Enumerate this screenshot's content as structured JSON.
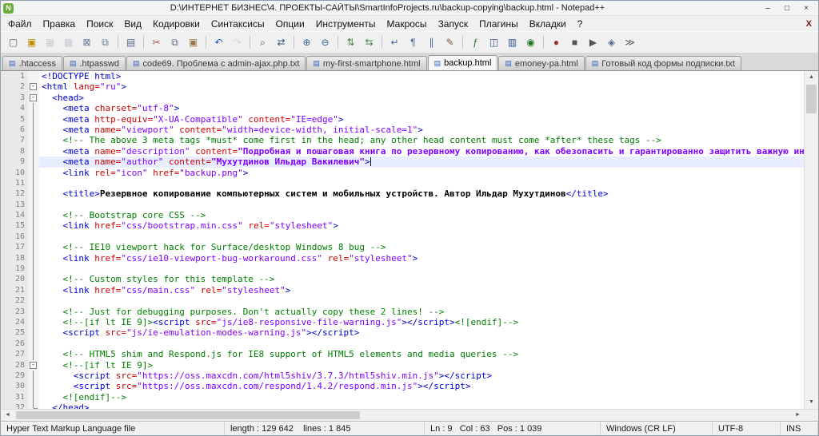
{
  "window": {
    "title": "D:\\ИНТЕРНЕТ БИЗНЕС\\4. ПРОЕКТЫ-САЙТЫ\\SmartInfoProjects.ru\\backup-copying\\backup.html - Notepad++",
    "app_initial": "N",
    "controls": {
      "minimize": "–",
      "maximize": "□",
      "close": "×"
    }
  },
  "menu": {
    "items": [
      "Файл",
      "Правка",
      "Поиск",
      "Вид",
      "Кодировки",
      "Синтаксисы",
      "Опции",
      "Инструменты",
      "Макросы",
      "Запуск",
      "Плагины",
      "Вкладки",
      "?"
    ],
    "close_label": "X"
  },
  "tab_icon_glyph": "▤",
  "tabs": [
    {
      "label": ".htaccess",
      "active": false
    },
    {
      "label": ".htpasswd",
      "active": false
    },
    {
      "label": "code69. Проблема с admin-ajax.php.txt",
      "active": false
    },
    {
      "label": "my-first-smartphone.html",
      "active": false
    },
    {
      "label": "backup.html",
      "active": true
    },
    {
      "label": "emoney-pa.html",
      "active": false
    },
    {
      "label": "Готовый код формы подписки.txt",
      "active": false
    }
  ],
  "toolbar": {
    "buttons": [
      {
        "name": "new-file",
        "glyph": "▢",
        "color": "#666666"
      },
      {
        "name": "open-file",
        "glyph": "▣",
        "color": "#c08f00"
      },
      {
        "name": "save",
        "glyph": "▦",
        "color": "#8899aa",
        "disabled": true
      },
      {
        "name": "save-all",
        "glyph": "▩",
        "color": "#8899aa",
        "disabled": true
      },
      {
        "name": "close",
        "glyph": "⊠",
        "color": "#667799"
      },
      {
        "name": "close-all",
        "glyph": "⧉",
        "color": "#667799"
      },
      {
        "name": "print",
        "glyph": "▤",
        "color": "#556688",
        "sep": true
      },
      {
        "name": "cut",
        "glyph": "✂",
        "color": "#aa5555",
        "sep": true
      },
      {
        "name": "copy",
        "glyph": "⧉",
        "color": "#556688"
      },
      {
        "name": "paste",
        "glyph": "▣",
        "color": "#997744"
      },
      {
        "name": "undo",
        "glyph": "↶",
        "color": "#2255cc",
        "sep": true
      },
      {
        "name": "redo",
        "glyph": "↷",
        "color": "#99aabb",
        "disabled": true
      },
      {
        "name": "find",
        "glyph": "⌕",
        "color": "#335577",
        "sep": true
      },
      {
        "name": "replace",
        "glyph": "⇄",
        "color": "#335577"
      },
      {
        "name": "zoom-in",
        "glyph": "⊕",
        "color": "#336699",
        "sep": true
      },
      {
        "name": "zoom-out",
        "glyph": "⊖",
        "color": "#336699"
      },
      {
        "name": "sync-vertical-scroll",
        "glyph": "⇅",
        "color": "#448844",
        "sep": true
      },
      {
        "name": "sync-horizontal-scroll",
        "glyph": "⇆",
        "color": "#448844"
      },
      {
        "name": "word-wrap",
        "glyph": "↵",
        "color": "#446699",
        "sep": true
      },
      {
        "name": "show-all-characters",
        "glyph": "¶",
        "color": "#446699"
      },
      {
        "name": "show-indent-guide",
        "glyph": "∥",
        "color": "#446699"
      },
      {
        "name": "user-defined-language",
        "glyph": "✎",
        "color": "#885533"
      },
      {
        "name": "function-list",
        "glyph": "ƒ",
        "color": "#227722",
        "sep": true
      },
      {
        "name": "document-map",
        "glyph": "◫",
        "color": "#335599"
      },
      {
        "name": "document-switcher",
        "glyph": "▥",
        "color": "#335599"
      },
      {
        "name": "monitoring",
        "glyph": "◉",
        "color": "#227722"
      },
      {
        "name": "record-macro",
        "glyph": "●",
        "color": "#993333",
        "sep": true
      },
      {
        "name": "stop-recording",
        "glyph": "■",
        "color": "#555555"
      },
      {
        "name": "play-macro",
        "glyph": "▶",
        "color": "#555555"
      },
      {
        "name": "save-macro",
        "glyph": "◈",
        "color": "#556699"
      },
      {
        "name": "run-macro-multiple-times",
        "glyph": "≫",
        "color": "#555555"
      }
    ]
  },
  "editor": {
    "lines": [
      {
        "n": 1,
        "fold": "",
        "segs": [
          [
            "t",
            "<!DOCTYPE html>"
          ]
        ]
      },
      {
        "n": 2,
        "fold": "box",
        "segs": [
          [
            "t",
            "<html "
          ],
          [
            "a",
            "lang="
          ],
          [
            "v",
            "\"ru\""
          ],
          [
            "t",
            ">"
          ]
        ]
      },
      {
        "n": 3,
        "fold": "box",
        "segs": [
          [
            "p",
            "  "
          ],
          [
            "t",
            "<head>"
          ]
        ]
      },
      {
        "n": 4,
        "fold": "v",
        "segs": [
          [
            "p",
            "    "
          ],
          [
            "t",
            "<meta "
          ],
          [
            "a",
            "charset="
          ],
          [
            "v",
            "\"utf-8\""
          ],
          [
            "t",
            ">"
          ]
        ]
      },
      {
        "n": 5,
        "fold": "v",
        "segs": [
          [
            "p",
            "    "
          ],
          [
            "t",
            "<meta "
          ],
          [
            "a",
            "http-equiv="
          ],
          [
            "v",
            "\"X-UA-Compatible\""
          ],
          [
            "p",
            " "
          ],
          [
            "a",
            "content="
          ],
          [
            "v",
            "\"IE=edge\""
          ],
          [
            "t",
            ">"
          ]
        ]
      },
      {
        "n": 6,
        "fold": "v",
        "segs": [
          [
            "p",
            "    "
          ],
          [
            "t",
            "<meta "
          ],
          [
            "a",
            "name="
          ],
          [
            "v",
            "\"viewport\""
          ],
          [
            "p",
            " "
          ],
          [
            "a",
            "content="
          ],
          [
            "v",
            "\"width=device-width, initial-scale=1\""
          ],
          [
            "t",
            ">"
          ]
        ]
      },
      {
        "n": 7,
        "fold": "v",
        "segs": [
          [
            "p",
            "    "
          ],
          [
            "c",
            "<!-- The above 3 meta tags *must* come first in the head; any other head content must come *after* these tags -->"
          ]
        ]
      },
      {
        "n": 8,
        "fold": "v",
        "segs": [
          [
            "p",
            "    "
          ],
          [
            "t",
            "<meta "
          ],
          [
            "a",
            "name="
          ],
          [
            "v",
            "\"description\""
          ],
          [
            "p",
            " "
          ],
          [
            "a",
            "content="
          ],
          [
            "v b",
            "\"Подробная и пошаговая книга по резервному копированию, как обезопасить и гарантированно защитить важную информацию от внез"
          ]
        ]
      },
      {
        "n": 9,
        "fold": "v",
        "hl": true,
        "caret": true,
        "segs": [
          [
            "p",
            "    "
          ],
          [
            "t",
            "<meta "
          ],
          [
            "a",
            "name="
          ],
          [
            "v",
            "\"author\""
          ],
          [
            "p",
            " "
          ],
          [
            "a",
            "content="
          ],
          [
            "v b",
            "\"Мухутдинов Ильдар Вакилевич\""
          ],
          [
            "t",
            ">"
          ]
        ]
      },
      {
        "n": 10,
        "fold": "v",
        "segs": [
          [
            "p",
            "    "
          ],
          [
            "t",
            "<link "
          ],
          [
            "a",
            "rel="
          ],
          [
            "v",
            "\"icon\""
          ],
          [
            "p",
            " "
          ],
          [
            "a",
            "href="
          ],
          [
            "v",
            "\"backup.png\""
          ],
          [
            "t",
            ">"
          ]
        ]
      },
      {
        "n": 11,
        "fold": "v",
        "segs": []
      },
      {
        "n": 12,
        "fold": "v",
        "segs": [
          [
            "p",
            "    "
          ],
          [
            "t",
            "<title>"
          ],
          [
            "x b",
            "Резервное копирование компьютерных систем и мобильных устройств. Автор Ильдар Мухутдинов"
          ],
          [
            "t",
            "</title>"
          ]
        ]
      },
      {
        "n": 13,
        "fold": "v",
        "segs": []
      },
      {
        "n": 14,
        "fold": "v",
        "segs": [
          [
            "p",
            "    "
          ],
          [
            "c",
            "<!-- Bootstrap core CSS -->"
          ]
        ]
      },
      {
        "n": 15,
        "fold": "v",
        "segs": [
          [
            "p",
            "    "
          ],
          [
            "t",
            "<link "
          ],
          [
            "a",
            "href="
          ],
          [
            "v",
            "\"css/bootstrap.min.css\""
          ],
          [
            "p",
            " "
          ],
          [
            "a",
            "rel="
          ],
          [
            "v",
            "\"stylesheet\""
          ],
          [
            "t",
            ">"
          ]
        ]
      },
      {
        "n": 16,
        "fold": "v",
        "segs": []
      },
      {
        "n": 17,
        "fold": "v",
        "segs": [
          [
            "p",
            "    "
          ],
          [
            "c",
            "<!-- IE10 viewport hack for Surface/desktop Windows 8 bug -->"
          ]
        ]
      },
      {
        "n": 18,
        "fold": "v",
        "segs": [
          [
            "p",
            "    "
          ],
          [
            "t",
            "<link "
          ],
          [
            "a",
            "href="
          ],
          [
            "v",
            "\"css/ie10-viewport-bug-workaround.css\""
          ],
          [
            "p",
            " "
          ],
          [
            "a",
            "rel="
          ],
          [
            "v",
            "\"stylesheet\""
          ],
          [
            "t",
            ">"
          ]
        ]
      },
      {
        "n": 19,
        "fold": "v",
        "segs": []
      },
      {
        "n": 20,
        "fold": "v",
        "segs": [
          [
            "p",
            "    "
          ],
          [
            "c",
            "<!-- Custom styles for this template -->"
          ]
        ]
      },
      {
        "n": 21,
        "fold": "v",
        "segs": [
          [
            "p",
            "    "
          ],
          [
            "t",
            "<link "
          ],
          [
            "a",
            "href="
          ],
          [
            "v",
            "\"css/main.css\""
          ],
          [
            "p",
            " "
          ],
          [
            "a",
            "rel="
          ],
          [
            "v",
            "\"stylesheet\""
          ],
          [
            "t",
            ">"
          ]
        ]
      },
      {
        "n": 22,
        "fold": "v",
        "segs": []
      },
      {
        "n": 23,
        "fold": "v",
        "segs": [
          [
            "p",
            "    "
          ],
          [
            "c",
            "<!-- Just for debugging purposes. Don't actually copy these 2 lines! -->"
          ]
        ]
      },
      {
        "n": 24,
        "fold": "v",
        "segs": [
          [
            "p",
            "    "
          ],
          [
            "c",
            "<!--[if lt IE 9]>"
          ],
          [
            "t",
            "<script "
          ],
          [
            "a",
            "src="
          ],
          [
            "v",
            "\"js/ie8-responsive-file-warning.js\""
          ],
          [
            "t",
            "></script>"
          ],
          [
            "c",
            "<![endif]-->"
          ]
        ]
      },
      {
        "n": 25,
        "fold": "v",
        "segs": [
          [
            "p",
            "    "
          ],
          [
            "t",
            "<script "
          ],
          [
            "a",
            "src="
          ],
          [
            "v",
            "\"js/ie-emulation-modes-warning.js\""
          ],
          [
            "t",
            "></script>"
          ]
        ]
      },
      {
        "n": 26,
        "fold": "v",
        "segs": []
      },
      {
        "n": 27,
        "fold": "v",
        "segs": [
          [
            "p",
            "    "
          ],
          [
            "c",
            "<!-- HTML5 shim and Respond.js for IE8 support of HTML5 elements and media queries -->"
          ]
        ]
      },
      {
        "n": 28,
        "fold": "box",
        "segs": [
          [
            "p",
            "    "
          ],
          [
            "c",
            "<!--[if lt IE 9]>"
          ]
        ]
      },
      {
        "n": 29,
        "fold": "v",
        "segs": [
          [
            "p",
            "      "
          ],
          [
            "t",
            "<script "
          ],
          [
            "a",
            "src="
          ],
          [
            "v",
            "\"https://oss.maxcdn.com/html5shiv/3.7.3/html5shiv.min.js\""
          ],
          [
            "t",
            "></script>"
          ]
        ]
      },
      {
        "n": 30,
        "fold": "v",
        "segs": [
          [
            "p",
            "      "
          ],
          [
            "t",
            "<script "
          ],
          [
            "a",
            "src="
          ],
          [
            "v",
            "\"https://oss.maxcdn.com/respond/1.4.2/respond.min.js\""
          ],
          [
            "t",
            "></script>"
          ]
        ]
      },
      {
        "n": 31,
        "fold": "v",
        "segs": [
          [
            "p",
            "    "
          ],
          [
            "c",
            "<![endif]-->"
          ]
        ]
      },
      {
        "n": 32,
        "fold": "end",
        "segs": [
          [
            "p",
            "  "
          ],
          [
            "t",
            "</head>"
          ]
        ]
      }
    ]
  },
  "scroll": {
    "up": "▲",
    "down": "▼",
    "left": "◄",
    "right": "►"
  },
  "statusbar": {
    "file_type": "Hyper Text Markup Language file",
    "length_lines": "length : 129 642    lines : 1 845",
    "position": "Ln : 9   Col : 63   Pos : 1 039",
    "eol": "Windows (CR LF)",
    "encoding": "UTF-8",
    "insert_mode": "INS"
  }
}
